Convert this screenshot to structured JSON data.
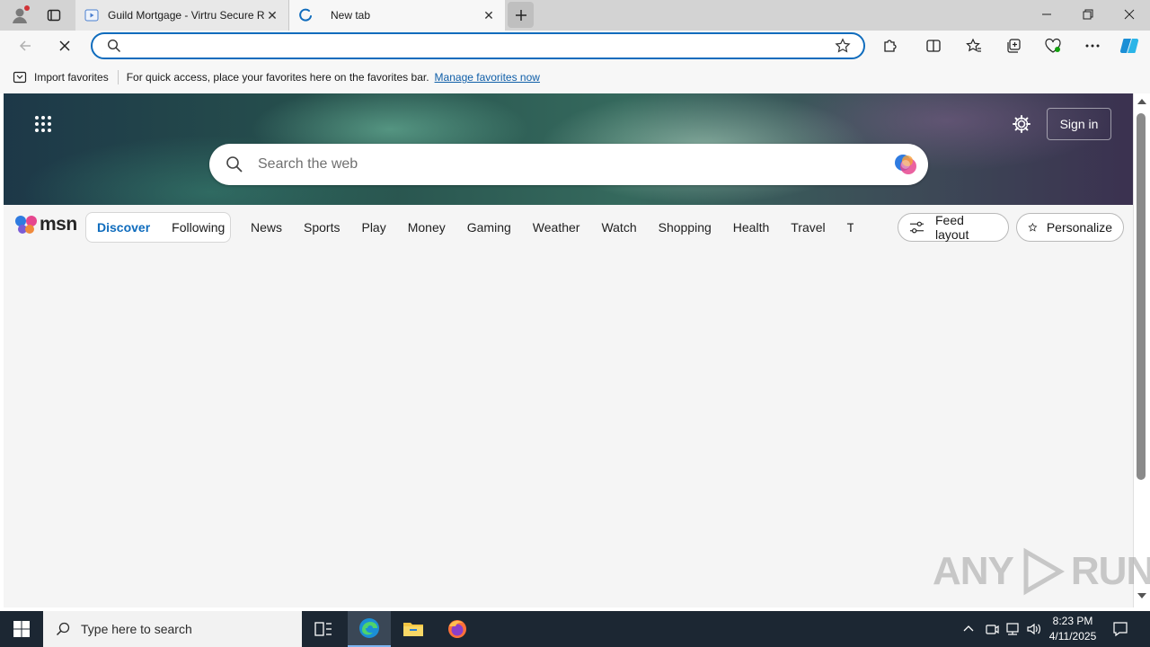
{
  "browser": {
    "tabs": [
      {
        "title": "Guild Mortgage - Virtru Secure R",
        "active": false
      },
      {
        "title": "New tab",
        "active": true
      }
    ],
    "address": {
      "value": ""
    },
    "favorites_bar": {
      "import_label": "Import favorites",
      "message": "For quick access, place your favorites here on the favorites bar.",
      "manage_link": "Manage favorites now"
    },
    "accent_color": "#0f6cbd"
  },
  "msn": {
    "search_placeholder": "Search the web",
    "sign_in": "Sign in",
    "logo_text": "msn",
    "pivot": [
      "Discover",
      "Following"
    ],
    "nav": [
      "News",
      "Sports",
      "Play",
      "Money",
      "Gaming",
      "Weather",
      "Watch",
      "Shopping",
      "Health",
      "Travel",
      "Traffic"
    ],
    "feed_layout": "Feed layout",
    "personalize": "Personalize"
  },
  "watermark": {
    "left": "ANY",
    "right": "RUN"
  },
  "taskbar": {
    "search_placeholder": "Type here to search",
    "time": "8:23 PM",
    "date": "4/11/2025"
  }
}
